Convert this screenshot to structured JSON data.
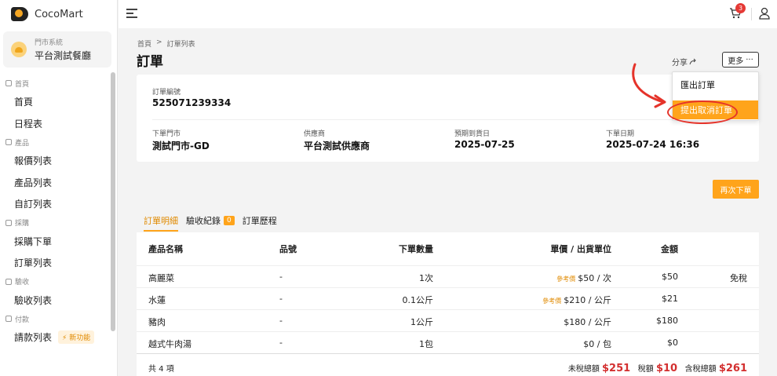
{
  "app": {
    "name": "CocoMart"
  },
  "store": {
    "system_label": "門市系統",
    "name": "平台測試餐廳"
  },
  "sidebar": {
    "groups": [
      {
        "label": "首頁",
        "items": [
          "首頁",
          "日程表"
        ]
      },
      {
        "label": "產品",
        "items": [
          "報價列表",
          "產品列表",
          "自訂列表"
        ]
      },
      {
        "label": "採購",
        "items": [
          "採購下單",
          "訂單列表"
        ]
      },
      {
        "label": "驗收",
        "items": [
          "驗收列表"
        ]
      },
      {
        "label": "付款",
        "items": [
          "請款列表"
        ]
      }
    ],
    "new_badge": "⚡ 新功能"
  },
  "topbar": {
    "cart_count": "3"
  },
  "breadcrumb": {
    "home": "首頁",
    "sep": ">",
    "current": "訂單列表"
  },
  "page": {
    "title": "訂單",
    "share": "分享",
    "more": "更多"
  },
  "dropdown": {
    "export": "匯出訂單",
    "cancel": "提出取消訂單"
  },
  "order": {
    "number_label": "訂單編號",
    "number": "525071239334",
    "store_label": "下單門市",
    "store": "測試門市-GD",
    "supplier_label": "供應商",
    "supplier": "平台測試供應商",
    "delivery_label": "預期到貨日",
    "delivery": "2025-07-25",
    "order_date_label": "下單日期",
    "order_date": "2025-07-24 16:36"
  },
  "reorder": "再次下單",
  "tabs": [
    {
      "label": "訂單明細",
      "active": true
    },
    {
      "label": "驗收紀錄",
      "badge": "0"
    },
    {
      "label": "訂單歷程"
    }
  ],
  "table": {
    "headers": [
      "產品名稱",
      "品號",
      "下單數量",
      "單價 / 出貨單位",
      "金額"
    ],
    "rows": [
      {
        "name": "高麗菜",
        "code": "-",
        "qty": "1次",
        "ref": "參考價",
        "price": "$50 / 次",
        "amount": "$50",
        "tax": "免稅"
      },
      {
        "name": "水蓮",
        "code": "-",
        "qty": "0.1公斤",
        "ref": "參考價",
        "price": "$210 / 公斤",
        "amount": "$21",
        "tax": ""
      },
      {
        "name": "豬肉",
        "code": "-",
        "qty": "1公斤",
        "ref": "",
        "price": "$180 / 公斤",
        "amount": "$180",
        "tax": ""
      },
      {
        "name": "越式牛肉湯",
        "code": "-",
        "qty": "1包",
        "ref": "",
        "price": "$0 / 包",
        "amount": "$0",
        "tax": ""
      }
    ],
    "footer": {
      "count": "共 4 項",
      "pretax_label": "未稅總額",
      "pretax": "$251",
      "tax_label": "稅額",
      "tax": "$10",
      "total_label": "含稅總額",
      "total": "$261"
    }
  },
  "colors": {
    "accent": "#ffa41b",
    "red": "#d32f2f"
  }
}
